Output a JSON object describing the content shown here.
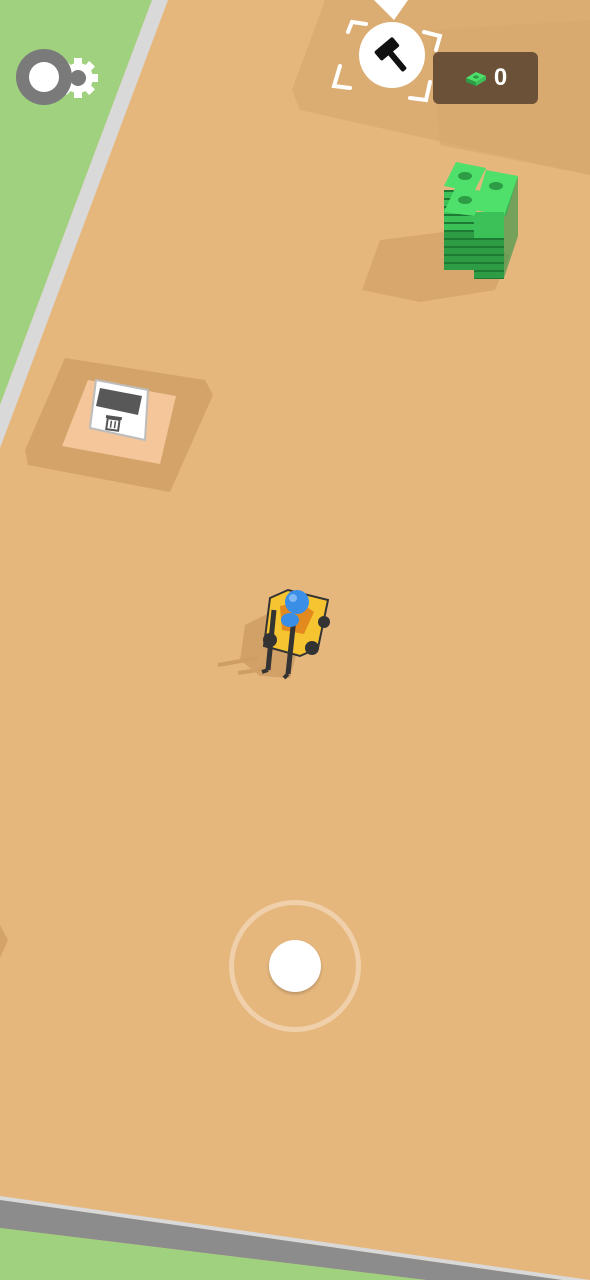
{
  "hud": {
    "money": "0",
    "settings_icon": "gear-icon",
    "money_icon": "cash-icon"
  },
  "world": {
    "build_zone_icon": "hammer-icon",
    "trash_bin_icon": "trash-icon",
    "vehicle": "forklift",
    "cash_stack": "cash-stack"
  },
  "colors": {
    "ground": "#e6b77d",
    "grass": "#9fd17f",
    "road": "#8c8c8c",
    "money_panel": "#6b5138",
    "cash": "#3fca5b",
    "forklift": "#f5c430",
    "driver": "#3a8ee6"
  }
}
